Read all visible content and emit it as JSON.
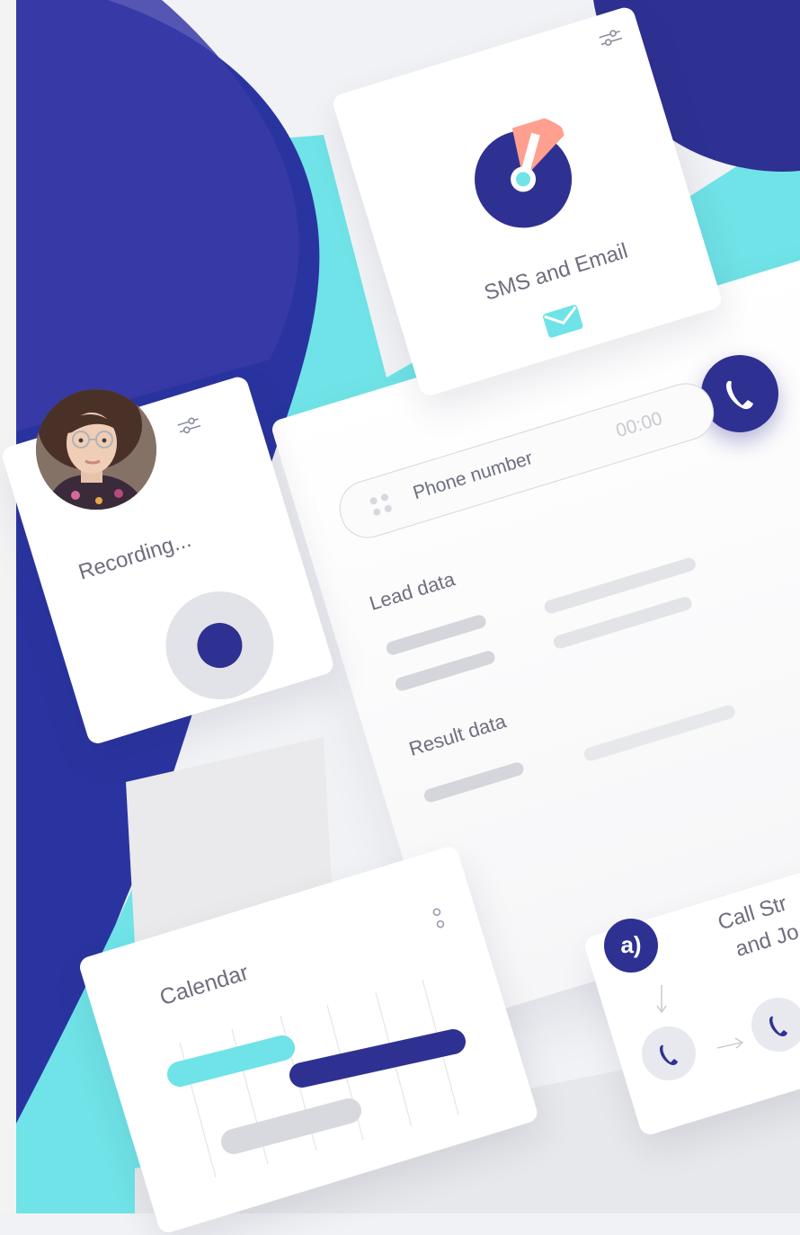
{
  "sms_card": {
    "title": "SMS and Email",
    "icon": "envelope-icon",
    "settings_icon": "sliders-icon"
  },
  "recording_card": {
    "status": "Recording...",
    "settings_icon": "sliders-icon",
    "avatar_alt": "user-avatar"
  },
  "dialer": {
    "placeholder": "Phone number",
    "timer": "00:00",
    "call_icon": "phone-icon",
    "keypad_icon": "dialpad-icon"
  },
  "form": {
    "lead_heading": "Lead data",
    "result_heading": "Result data"
  },
  "calendar_card": {
    "title": "Calendar",
    "menu_icon": "more-vertical-icon"
  },
  "call_card": {
    "title_line1": "Call Str",
    "title_line2": "and Jo",
    "brand_badge": "a)"
  },
  "colors": {
    "navy": "#2e3192",
    "navy_dark": "#232a8a",
    "cyan": "#6fe3e7",
    "salmon": "#ff9f8f",
    "gray_pill": "#d9dae0"
  }
}
